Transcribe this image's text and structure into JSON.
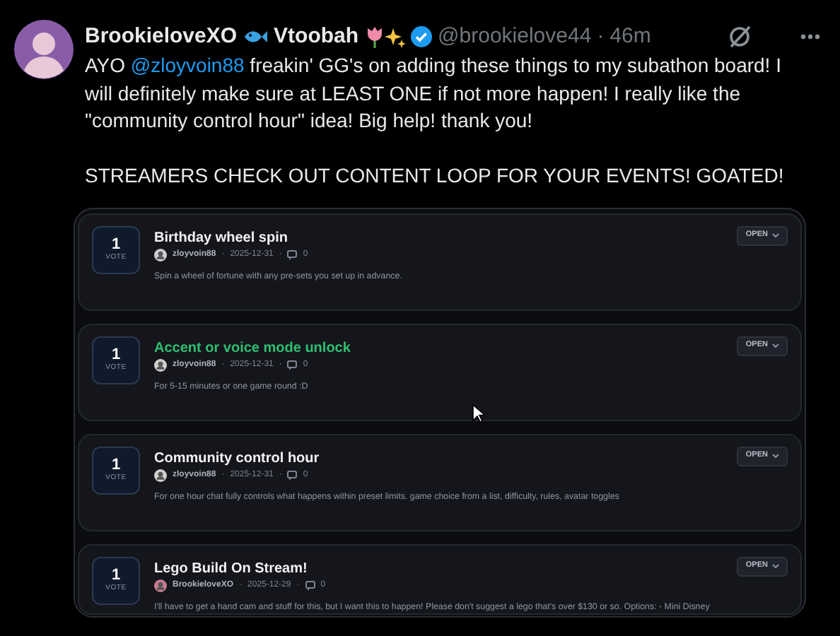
{
  "post": {
    "display_name": "BrookieloveXO",
    "display_name_2": "Vtoobah",
    "handle": "@brookielove44",
    "separator": "·",
    "time": "46m",
    "verified": true,
    "body": [
      {
        "before": "AYO ",
        "mention": "@zloyvoin88",
        "after": " freakin' GG's on adding these things to my subathon board! I will definitely make sure at LEAST ONE if not more happen! I really like the \"community control hour\" idea! Big help! thank you!"
      },
      {
        "before": "STREAMERS CHECK OUT CONTENT LOOP FOR YOUR EVENTS! GOATED!"
      }
    ]
  },
  "board": {
    "items": [
      {
        "votes": "1",
        "vote_label": "VOTE",
        "title": "Birthday wheel spin",
        "hovered": false,
        "author": "zloyvoin88",
        "date": "2025-12-31",
        "comments": "0",
        "description": "Spin a wheel of fortune with any pre-sets you set up in advance.",
        "status": "OPEN"
      },
      {
        "votes": "1",
        "vote_label": "VOTE",
        "title": "Accent or voice mode unlock",
        "hovered": true,
        "author": "zloyvoin88",
        "date": "2025-12-31",
        "comments": "0",
        "description": "For 5-15 minutes or one game round :D",
        "status": "OPEN"
      },
      {
        "votes": "1",
        "vote_label": "VOTE",
        "title": "Community control hour",
        "hovered": false,
        "author": "zloyvoin88",
        "date": "2025-12-31",
        "comments": "0",
        "description": "For one hour chat fully controls what happens within preset limits. game choice from a list, difficulty, rules, avatar toggles",
        "status": "OPEN"
      },
      {
        "votes": "1",
        "vote_label": "VOTE",
        "title": "Lego Build On Stream!",
        "hovered": false,
        "author": "BrookieloveXO",
        "date": "2025-12-29",
        "comments": "0",
        "description": "I'll have to get a hand cam and stuff for this, but I want this to happen! Please don't suggest a lego that's over $130 or so. Options: - Mini Disney",
        "status": "OPEN"
      }
    ]
  }
}
